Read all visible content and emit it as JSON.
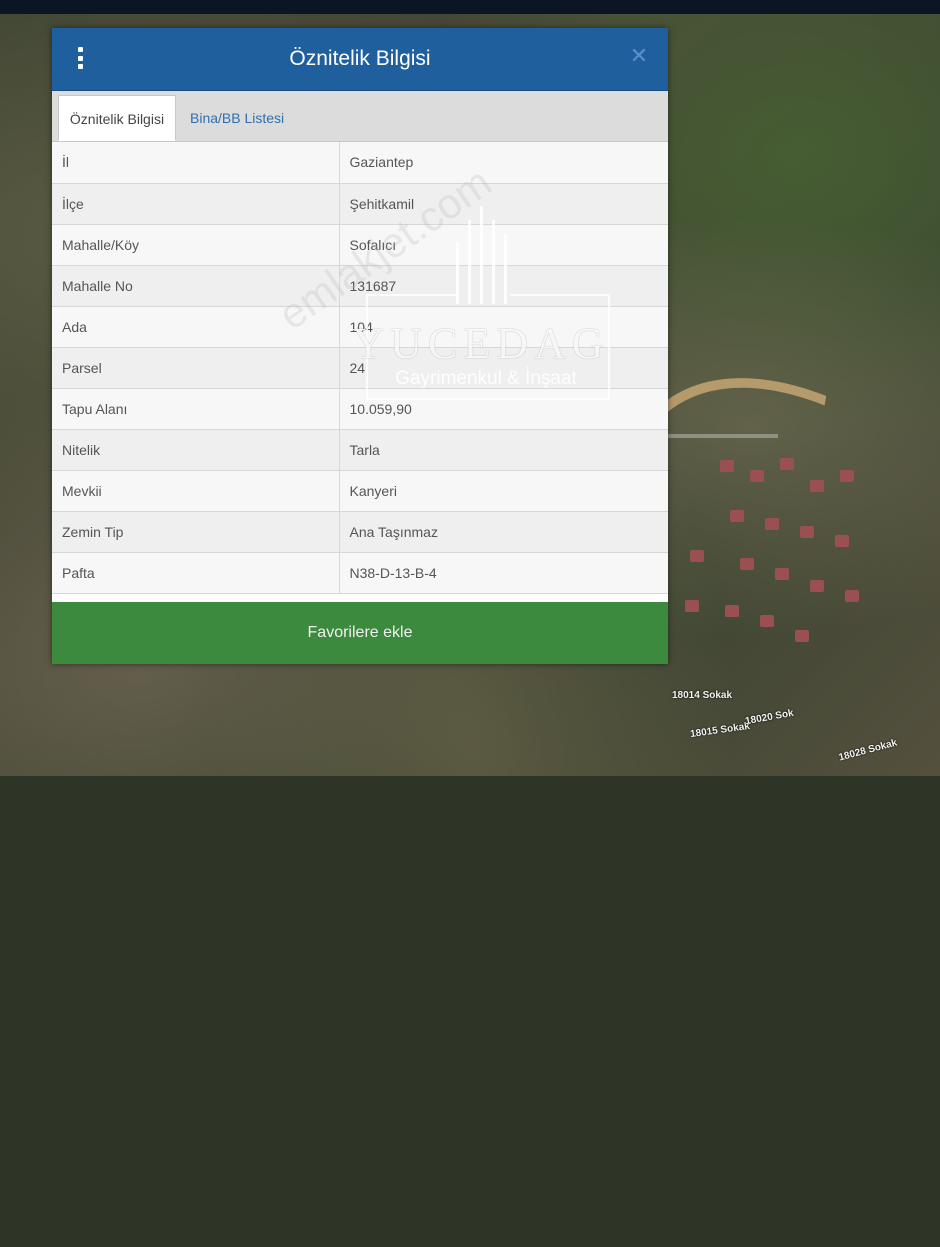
{
  "dialog": {
    "title": "Öznitelik Bilgisi",
    "close_symbol": "✕",
    "tabs": [
      {
        "label": "Öznitelik Bilgisi",
        "active": true
      },
      {
        "label": "Bina/BB Listesi",
        "active": false
      }
    ],
    "rows": [
      {
        "key": "İl",
        "value": "Gaziantep"
      },
      {
        "key": "İlçe",
        "value": "Şehitkamil"
      },
      {
        "key": "Mahalle/Köy",
        "value": "Sofalıcı"
      },
      {
        "key": "Mahalle No",
        "value": "131687"
      },
      {
        "key": "Ada",
        "value": "104"
      },
      {
        "key": "Parsel",
        "value": "24"
      },
      {
        "key": "Tapu Alanı",
        "value": "10.059,90"
      },
      {
        "key": "Nitelik",
        "value": "Tarla"
      },
      {
        "key": "Mevkii",
        "value": "Kanyeri"
      },
      {
        "key": "Zemin Tip",
        "value": "Ana Taşınmaz"
      },
      {
        "key": "Pafta",
        "value": "N38-D-13-B-4"
      }
    ],
    "favorite_button": "Favorilere ekle"
  },
  "watermark": {
    "brand": "YUCEDAG",
    "subtitle": "Gayrimenkul & İnşaat",
    "url": "emlakjet.com"
  },
  "map": {
    "street_labels": [
      "18014 Sokak",
      "18015 Sokak",
      "18020 Sok",
      "18028 Sokak"
    ]
  },
  "colors": {
    "header": "#1f5f9e",
    "tab_link": "#2f6fb0",
    "favorite_button": "#3b8a3d"
  },
  "icons": {
    "menu": "vertical-dots-icon",
    "close": "close-icon"
  }
}
